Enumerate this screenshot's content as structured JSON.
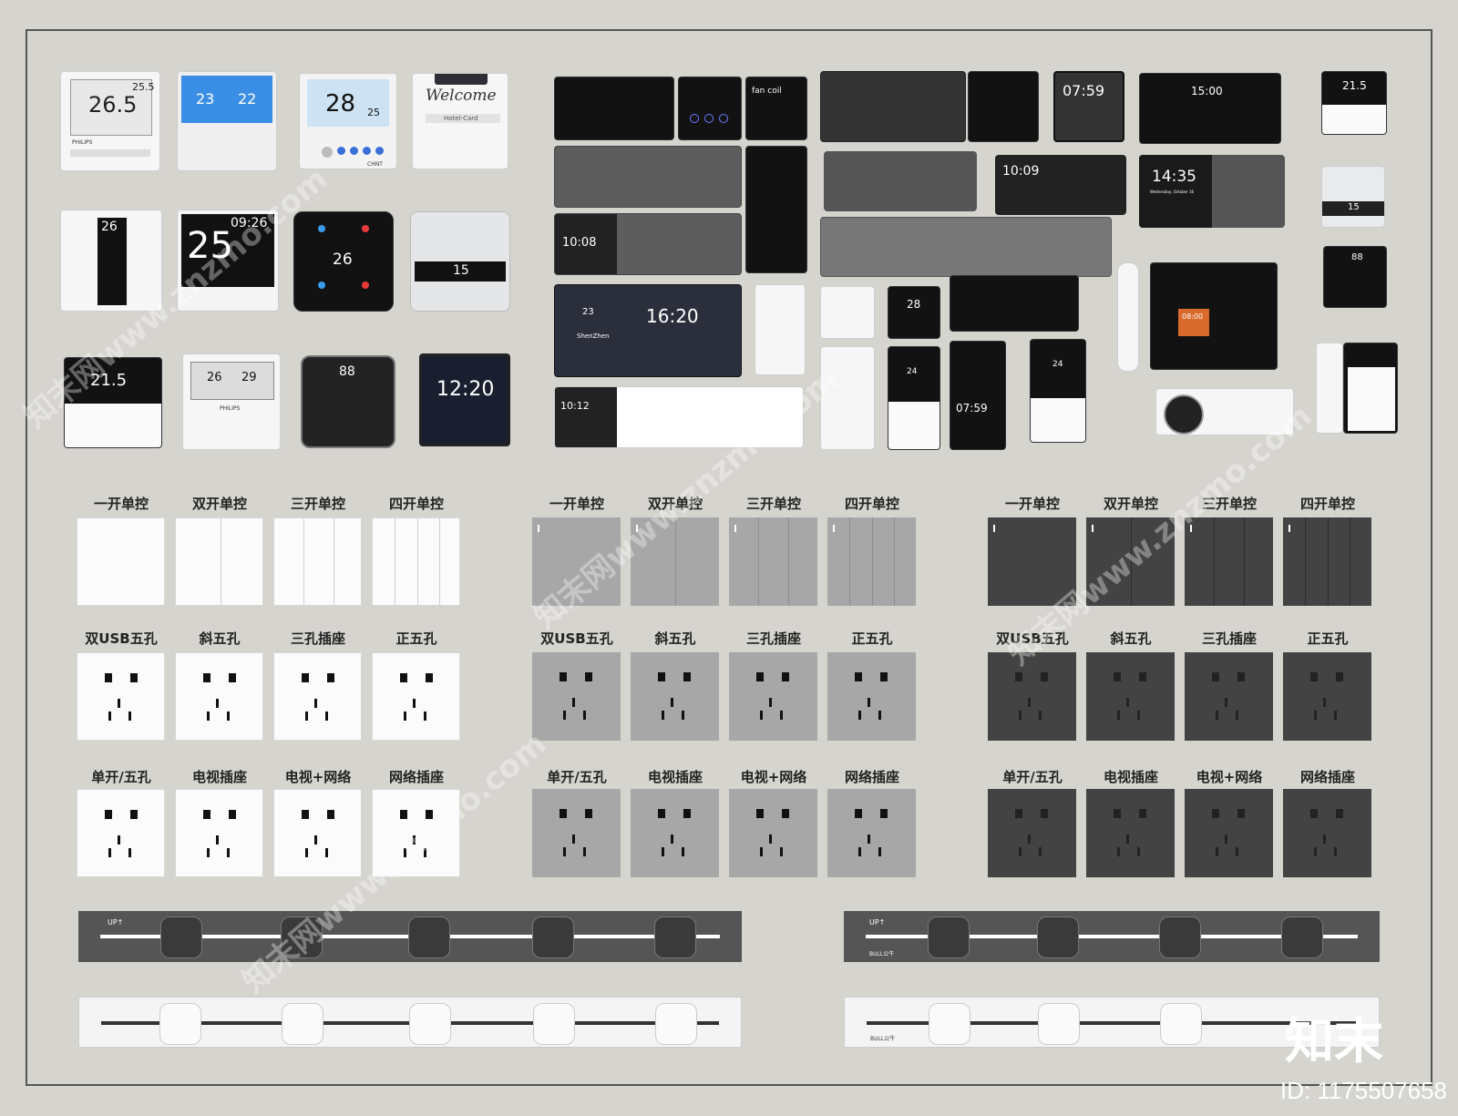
{
  "thermostats": {
    "t1_temp": "26.5",
    "t1_set": "25.5",
    "t1_brand": "PHILIPS",
    "t2_left": "23",
    "t2_right": "22",
    "t3_temp": "28",
    "t3_set": "25",
    "t3_brand": "CHNT",
    "t4_text": "Welcome",
    "t4_card": "Hotel-Card",
    "t5_temp": "26",
    "t6_big": "25",
    "t6_time": "09:26",
    "t7_temp": "26",
    "t8_temp": "15",
    "t9_temp": "21.5",
    "t10_left": "26",
    "t10_right": "29",
    "t10_brand": "PHILIPS",
    "t11_temp": "88",
    "t12_time": "12:20"
  },
  "screens": {
    "fan_coil": "fan coil",
    "s_1008": "10:08",
    "s_1620": "16:20",
    "s_23": "23",
    "s_city": "ShenZhen",
    "s_1012": "10:12",
    "s_0759a": "07:59",
    "s_1500": "15:00",
    "s_1009": "10:09",
    "s_1435": "14:35",
    "s_date": "Wednesday, October 16",
    "s_28": "28",
    "s_24a": "24",
    "s_24b": "24",
    "s_0759b": "07:59",
    "s_0800": "08:00",
    "s_215": "21.5",
    "s_15": "15",
    "s_88": "88"
  },
  "switch_labels": [
    "一开单控",
    "双开单控",
    "三开单控",
    "四开单控"
  ],
  "socket_labels": [
    "双USB五孔",
    "斜五孔",
    "三孔插座",
    "正五孔"
  ],
  "socket_labels2": [
    "单开/五孔",
    "电视插座",
    "电视+网络",
    "网络插座"
  ],
  "strip_text": "UP↑",
  "strip_brand": "BULL公牛",
  "watermark": "知末网www.znzmo.com",
  "logo_text": "知末",
  "id_text": "ID: 1175507658",
  "colors": {
    "background": "#d6d4cf",
    "white": "#fbfbfb",
    "gray": "#a7a7a7",
    "dark": "#434343"
  }
}
